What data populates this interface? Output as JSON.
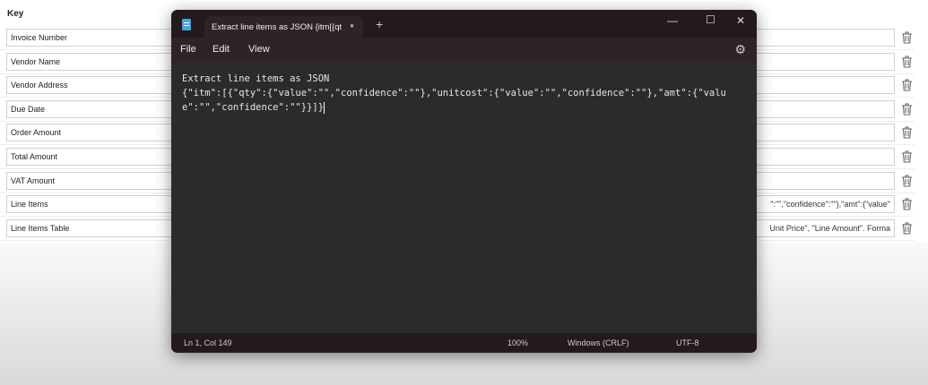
{
  "form": {
    "key_label": "Key",
    "rows": [
      {
        "key": "Invoice Number",
        "value": ""
      },
      {
        "key": "Vendor Name",
        "value": ""
      },
      {
        "key": "Vendor Address",
        "value": ""
      },
      {
        "key": "Due Date",
        "value": ""
      },
      {
        "key": "Order Amount",
        "value": ""
      },
      {
        "key": "Total Amount",
        "value": ""
      },
      {
        "key": "VAT Amount",
        "value": ""
      },
      {
        "key": "Line Items",
        "value": "\":\"\",\"confidence\":\"\"},\"amt\":{\"value\""
      },
      {
        "key": "Line Items Table",
        "value": "Unit Price\", \"Line Amount\". Forma"
      }
    ]
  },
  "notepad": {
    "tab_title": "Extract line items as JSON {itm[{qt",
    "menu": [
      "File",
      "Edit",
      "View"
    ],
    "lines": [
      "Extract line items as JSON",
      "{\"itm\":[{\"qty\":{\"value\":\"\",\"confidence\":\"\"},\"unitcost\":{\"value\":\"\",\"confidence\":\"\"},\"amt\":{\"value\":\"\",\"confidence\":\"\"}}]}"
    ],
    "status": {
      "position": "Ln 1, Col 149",
      "zoom": "100%",
      "line_ending": "Windows (CRLF)",
      "encoding": "UTF-8"
    }
  }
}
